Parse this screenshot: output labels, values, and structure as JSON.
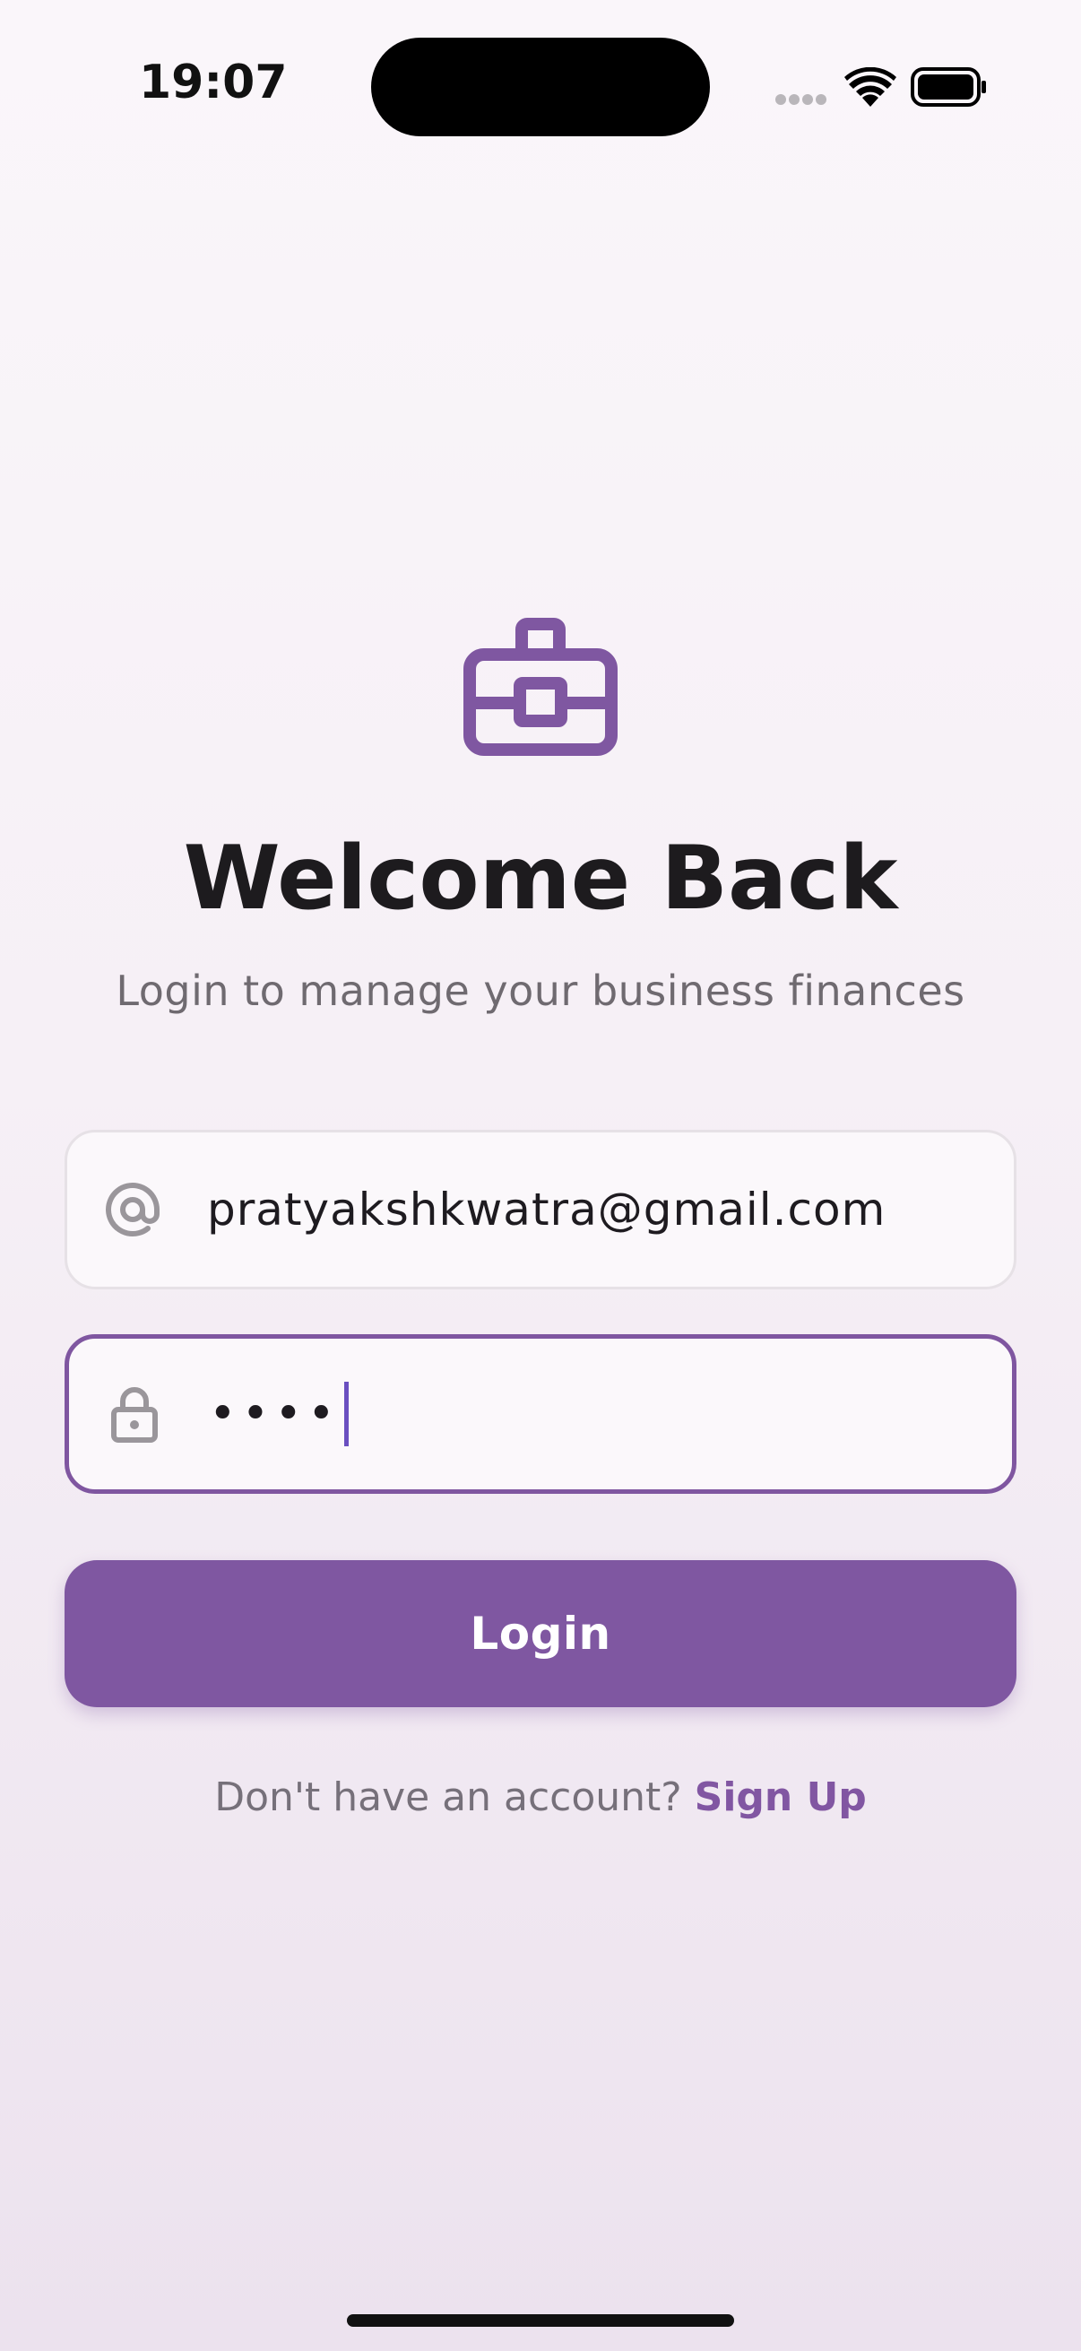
{
  "status_bar": {
    "time": "19:07"
  },
  "header": {
    "icon": "briefcase-icon",
    "title": "Welcome Back",
    "subtitle": "Login to manage your business finances"
  },
  "form": {
    "email": {
      "icon": "at-sign-icon",
      "value": "pratyakshkwatra@gmail.com"
    },
    "password": {
      "icon": "lock-icon",
      "value": "••••",
      "focused": true
    },
    "login_label": "Login"
  },
  "footer": {
    "prompt": "Don't have an account?",
    "link_label": "Sign Up"
  },
  "colors": {
    "accent": "#7f57a1",
    "title": "#1d1b1e",
    "muted": "#6f6a70",
    "icon_gray": "#9a969b"
  }
}
